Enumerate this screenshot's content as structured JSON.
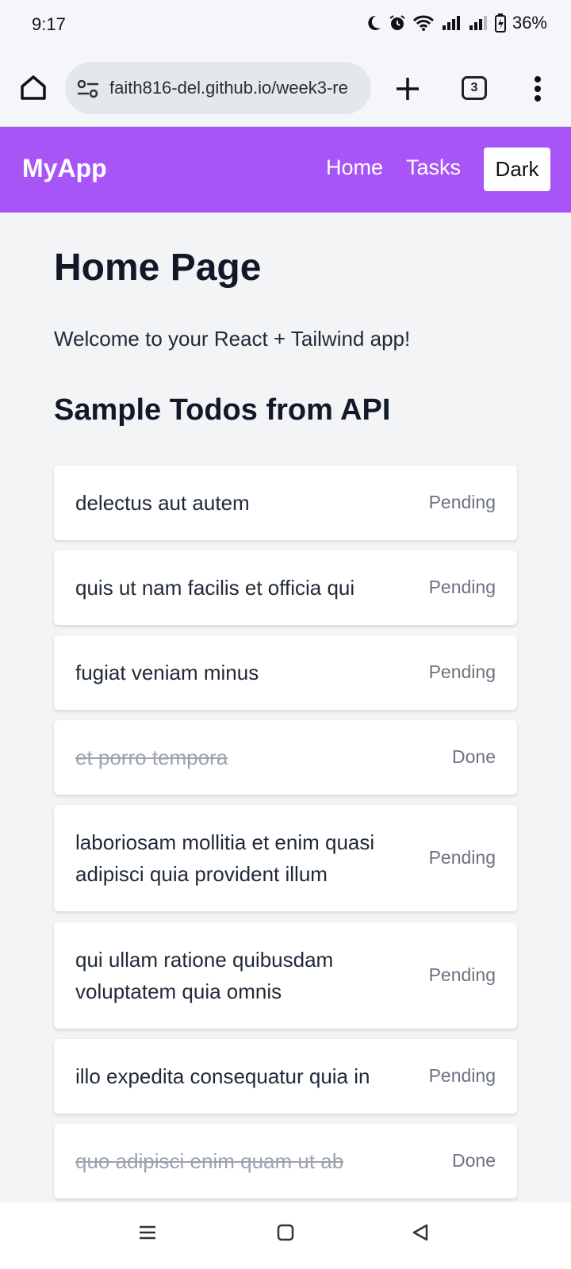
{
  "status_bar": {
    "time": "9:17",
    "battery": "36%",
    "icons": [
      "moon-icon",
      "alarm-icon",
      "wifi-icon",
      "signal-icon",
      "signal-icon",
      "battery-icon"
    ]
  },
  "browser": {
    "url": "faith816-del.github.io/week3-re",
    "tab_count": "3",
    "icons": [
      "home-icon",
      "tune-icon",
      "plus-icon",
      "tabs-icon",
      "more-vert-icon"
    ]
  },
  "navbar": {
    "brand": "MyApp",
    "links": [
      "Home",
      "Tasks"
    ],
    "theme_button": "Dark",
    "color": "#a855f7"
  },
  "page": {
    "title": "Home Page",
    "welcome": "Welcome to your React + Tailwind app!",
    "section_title": "Sample Todos from API"
  },
  "todos": [
    {
      "title": "delectus aut autem",
      "status": "Pending",
      "completed": false
    },
    {
      "title": "quis ut nam facilis et officia qui",
      "status": "Pending",
      "completed": false
    },
    {
      "title": "fugiat veniam minus",
      "status": "Pending",
      "completed": false
    },
    {
      "title": "et porro tempora",
      "status": "Done",
      "completed": true
    },
    {
      "title": "laboriosam mollitia et enim quasi adipisci quia provident illum",
      "status": "Pending",
      "completed": false
    },
    {
      "title": "qui ullam ratione quibusdam voluptatem quia omnis",
      "status": "Pending",
      "completed": false
    },
    {
      "title": "illo expedita consequatur quia in",
      "status": "Pending",
      "completed": false
    },
    {
      "title": "quo adipisci enim quam ut ab",
      "status": "Done",
      "completed": true
    }
  ],
  "system_nav": [
    "recents-icon",
    "home-circle-icon",
    "back-icon"
  ]
}
